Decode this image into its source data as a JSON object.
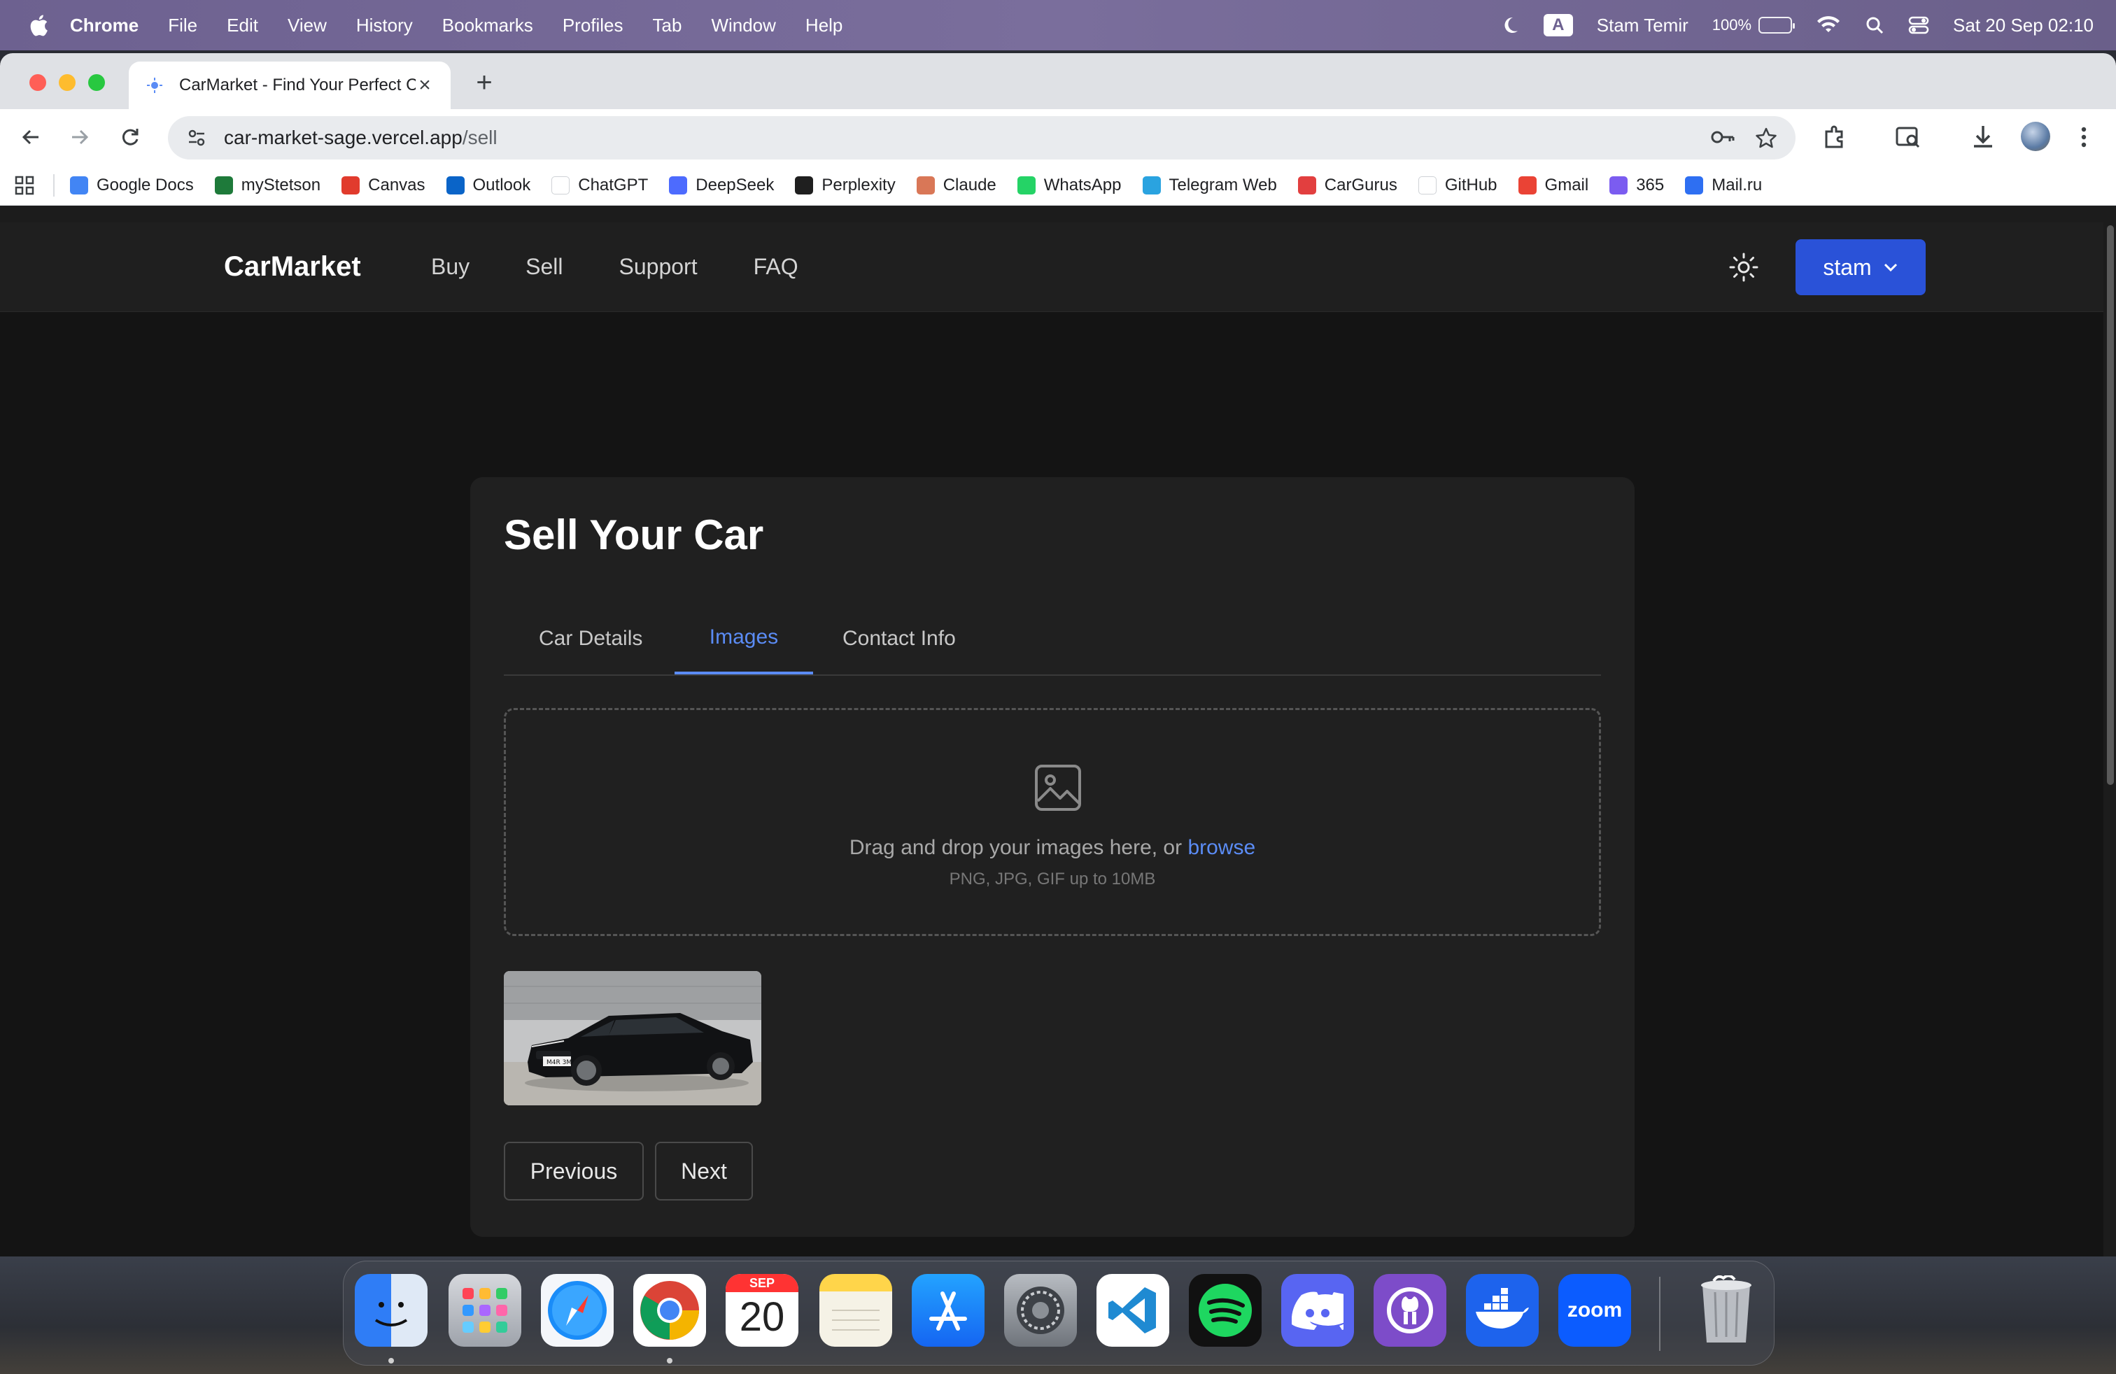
{
  "menubar": {
    "app_name": "Chrome",
    "menus": [
      "File",
      "Edit",
      "View",
      "History",
      "Bookmarks",
      "Profiles",
      "Tab",
      "Window",
      "Help"
    ],
    "input_source": "A",
    "user": "Stam Temir",
    "battery": "100%",
    "datetime": "Sat 20 Sep  02:10"
  },
  "browser": {
    "tab_title": "CarMarket - Find Your Perfect Car",
    "url_host": "car-market-sage.vercel.app",
    "url_path": "/sell",
    "bookmarks": [
      {
        "label": "Google Docs",
        "icon": "google-docs-icon",
        "color": "#4285f4"
      },
      {
        "label": "myStetson",
        "icon": "stetson-icon",
        "color": "#1e7a3a"
      },
      {
        "label": "Canvas",
        "icon": "canvas-icon",
        "color": "#e13b2d"
      },
      {
        "label": "Outlook",
        "icon": "outlook-icon",
        "color": "#0a64c8"
      },
      {
        "label": "ChatGPT",
        "icon": "chatgpt-icon",
        "color": "#ffffff"
      },
      {
        "label": "DeepSeek",
        "icon": "deepseek-icon",
        "color": "#4d6bfe"
      },
      {
        "label": "Perplexity",
        "icon": "perplexity-icon",
        "color": "#1f1f1f"
      },
      {
        "label": "Claude",
        "icon": "claude-icon",
        "color": "#d97757"
      },
      {
        "label": "WhatsApp",
        "icon": "whatsapp-icon",
        "color": "#25d366"
      },
      {
        "label": "Telegram Web",
        "icon": "telegram-icon",
        "color": "#2aa3e0"
      },
      {
        "label": "CarGurus",
        "icon": "cargurus-icon",
        "color": "#e23f3f"
      },
      {
        "label": "GitHub",
        "icon": "github-icon",
        "color": "#ffffff"
      },
      {
        "label": "Gmail",
        "icon": "gmail-icon",
        "color": "#ea4335"
      },
      {
        "label": "365",
        "icon": "microsoft365-icon",
        "color": "#7b5cf0"
      },
      {
        "label": "Mail.ru",
        "icon": "mailru-icon",
        "color": "#2e6ff2"
      }
    ]
  },
  "site": {
    "brand": "CarMarket",
    "nav": [
      "Buy",
      "Sell",
      "Support",
      "FAQ"
    ],
    "user_button": "stam",
    "accent": "#2a52d8"
  },
  "sell_form": {
    "title": "Sell Your Car",
    "tabs": [
      {
        "label": "Car Details",
        "active": false
      },
      {
        "label": "Images",
        "active": true
      },
      {
        "label": "Contact Info",
        "active": false
      }
    ],
    "dropzone": {
      "text": "Drag and drop your images here, or ",
      "link": "browse",
      "hint": "PNG, JPG, GIF up to 10MB"
    },
    "uploaded_images": [
      {
        "plate": "M4R 3M"
      }
    ],
    "buttons": {
      "previous": "Previous",
      "next": "Next"
    }
  },
  "dock": {
    "calendar_month": "SEP",
    "calendar_day": "20",
    "zoom_label": "zoom",
    "apps": [
      "Finder",
      "Launchpad",
      "Safari",
      "Chrome",
      "Calendar",
      "Notes",
      "App Store",
      "System Settings",
      "VS Code",
      "Spotify",
      "Discord",
      "GitHub Desktop",
      "Docker",
      "Zoom",
      "Trash"
    ]
  }
}
